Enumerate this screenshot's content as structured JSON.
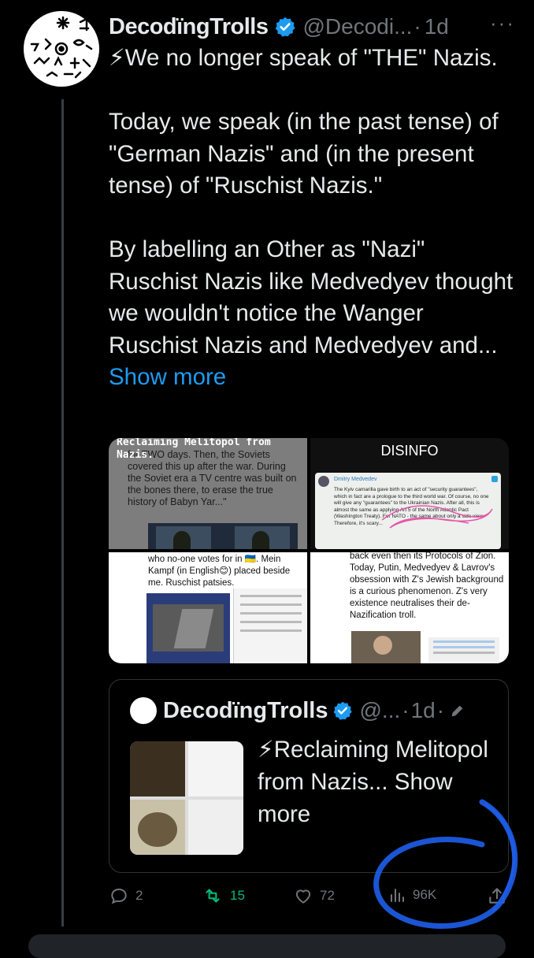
{
  "tweet": {
    "author_name": "DecodïngTrolls",
    "handle": "@Decodi...",
    "dot": "·",
    "time": "1d",
    "more_label": "···",
    "paragraphs": [
      "⚡We no longer speak of \"THE\" Nazis.",
      "Today, we speak (in the past tense) of \"German Nazis\" and (in the present tense) of \"Ruschist Nazis.\"",
      "By labelling an Other as \"Nazi\" Ruschist Nazis like Medvedyev thought we wouldn't notice the Wanger Ruschist Nazis and Medvedyev and..."
    ],
    "show_more": "Show more"
  },
  "media": {
    "tile1": {
      "title": "Reclaiming Melitopol from Nazis.",
      "caption": "for TWO days. Then, the Soviets covered this up after the war. During the Soviet era a TV centre was built on the bones there, to erase the true history of Babyn Yar...\""
    },
    "tile2": {
      "label": "DISINFO",
      "author": "Dmitry Medvedev",
      "message": "The Kyiv camarilla gave birth to an act of \"security guarantees\", which in fact are a prologue to the third world war. Of course, no one will give any \"guarantees\" to the Ukrainian Nazis. After all, this is almost the same as applying Art 5 of the North Atlantic Pact (Washington Treaty). For NATO - the same about only a side view. Therefore, it's scary..."
    },
    "tile3": {
      "caption": "who no-one votes for in 🇺🇦. Mein Kampf (in English😊) placed beside me. Ruschist patsies."
    },
    "tile4": {
      "caption": "back even then its Protocols of Zion. Today, Putin, Medvedyev & Lavrov's obsession with Z's Jewish background is a curious phenomenon. Z's very existence neutralises their de-Nazification troll."
    }
  },
  "quote": {
    "author_name": "DecodïngTrolls",
    "handle": "@...",
    "dot": "·",
    "time": "1d",
    "dot2": "·",
    "text": "⚡Reclaiming Melitopol from Nazis...",
    "show_more": "Show more"
  },
  "actions": {
    "replies": "2",
    "retweets": "15",
    "likes": "72",
    "views": "96K"
  },
  "colors": {
    "accent": "#1d9bf0",
    "retweet": "#00ba7c",
    "muted": "#71767b",
    "annotation": "#1e5eea"
  }
}
